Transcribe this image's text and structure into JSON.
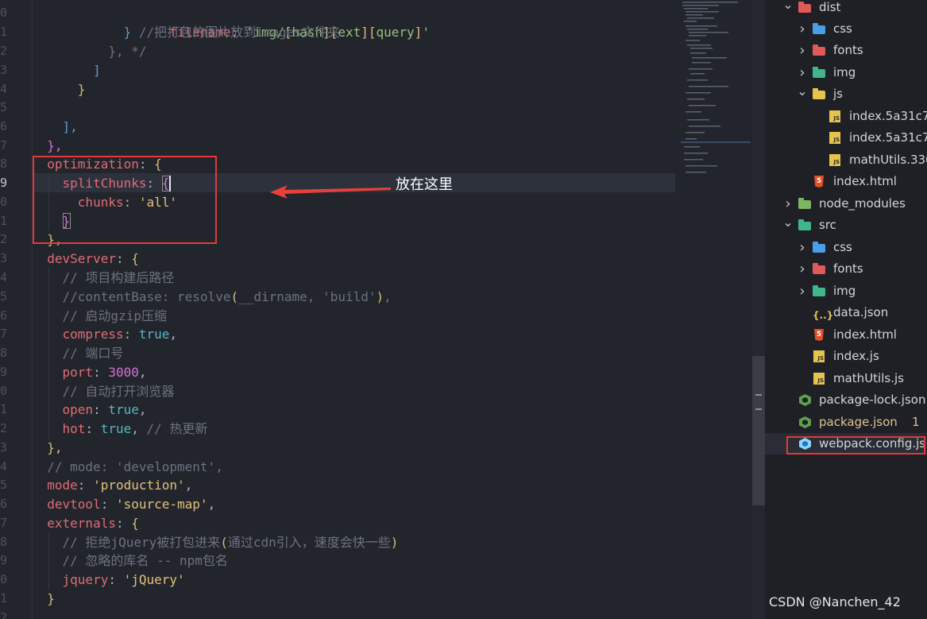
{
  "editor": {
    "line_numbers": [
      "0",
      "1",
      "2",
      "3",
      "4",
      "5",
      "6",
      "7",
      "8",
      "9",
      "0",
      "1",
      "2",
      "3",
      "4",
      "5",
      "6",
      "7",
      "8",
      "9",
      "0",
      "1",
      "2",
      "3",
      "4",
      "5",
      "6",
      "7",
      "8",
      "9",
      "0",
      "1",
      "2"
    ],
    "active_line_index": 9,
    "lines": {
      "l0_filename_key": "filename",
      "l0_filename_value": "'img/[hash][ext][query]'",
      "l1_comment": "//把打包的图片放到images文件夹",
      "l2_close": "}, */",
      "l3_bracket": "]",
      "l4_brace": "}",
      "l6_bracket": "],",
      "l7_brace": "},",
      "l8_key": "optimization",
      "l9_key": "splitChunks",
      "l10_key": "chunks",
      "l10_value": "'all'",
      "l11_brace": "}",
      "l12_brace": "},",
      "l13_key": "devServer",
      "l14_comment": "// 项目构建后路径",
      "l15_comment_a": "//contentBase: resolve",
      "l15_comment_b": "__dirname, 'build'",
      "l16_comment": "// 启动gzip压缩",
      "l17_key": "compress",
      "l17_value": "true",
      "l18_comment": "// 端口号",
      "l19_key": "port",
      "l19_value": "3000",
      "l20_comment": "// 自动打开浏览器",
      "l21_key": "open",
      "l21_value": "true",
      "l22_key": "hot",
      "l22_value": "true",
      "l22_comment": "// 热更新",
      "l23_brace": "},",
      "l24_comment": "// mode: 'development',",
      "l25_key": "mode",
      "l25_value": "'production'",
      "l26_key": "devtool",
      "l26_value": "'source-map'",
      "l27_key": "externals",
      "l28_comment_a": "// 拒绝jQuery被打包进来",
      "l28_comment_b": "通过cdn引入，速度会快一些",
      "l29_comment": "// 忽略的库名 -- npm包名",
      "l30_key": "jquery",
      "l30_value": "'jQuery'",
      "l31_brace": "}"
    },
    "annotation": "放在这里"
  },
  "explorer": {
    "items": [
      {
        "label": "dist",
        "type": "folder-open",
        "color": "#e05a5a"
      },
      {
        "label": "css",
        "type": "folder",
        "color": "#4a9ee5"
      },
      {
        "label": "fonts",
        "type": "folder",
        "color": "#e05a5a"
      },
      {
        "label": "img",
        "type": "folder",
        "color": "#3fb68b"
      },
      {
        "label": "js",
        "type": "folder-open",
        "color": "#e7c34c"
      },
      {
        "label": "index.5a31c7c3.",
        "type": "js"
      },
      {
        "label": "index.5a31c7c3.",
        "type": "js"
      },
      {
        "label": "mathUtils.3307..",
        "type": "js"
      },
      {
        "label": "index.html",
        "type": "html"
      },
      {
        "label": "node_modules",
        "type": "folder",
        "color": "#7bb661"
      },
      {
        "label": "src",
        "type": "folder-open",
        "color": "#3fb68b"
      },
      {
        "label": "css",
        "type": "folder",
        "color": "#4a9ee5"
      },
      {
        "label": "fonts",
        "type": "folder",
        "color": "#e05a5a"
      },
      {
        "label": "img",
        "type": "folder",
        "color": "#3fb68b"
      },
      {
        "label": "data.json",
        "type": "json"
      },
      {
        "label": "index.html",
        "type": "html"
      },
      {
        "label": "index.js",
        "type": "js"
      },
      {
        "label": "mathUtils.js",
        "type": "js"
      },
      {
        "label": "package-lock.json",
        "type": "node"
      },
      {
        "label": "package.json",
        "type": "node",
        "modified": true,
        "badge": "1"
      },
      {
        "label": "webpack.config.js",
        "type": "webpack",
        "highlighted": true
      }
    ]
  },
  "watermark": "CSDN @Nanchen_42",
  "colors": {
    "highlight_box": "#e03b3b",
    "modified_file": "#e2c08d"
  }
}
